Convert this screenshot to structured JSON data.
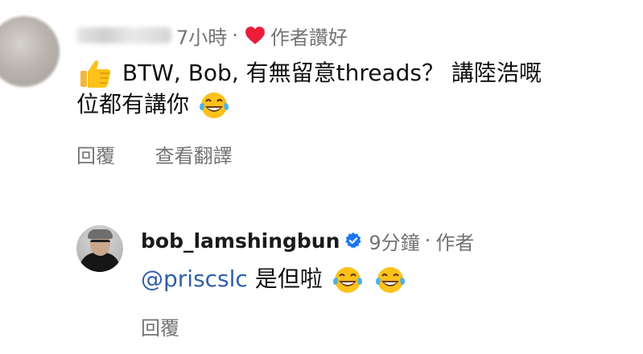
{
  "comments": [
    {
      "author_name_blurred": true,
      "time": "7小時",
      "separator": "·",
      "liked_by_author_label": "作者讚好",
      "text_line1": "BTW, Bob, 有無留意threads？ 講陸浩嘅",
      "text_line2": "位都有講你",
      "leading_emoji": "thumbs-up",
      "trailing_emoji": "face-with-tears-of-joy",
      "actions": [
        "回覆",
        "查看翻譯"
      ]
    },
    {
      "username": "bob_lamshingbun",
      "verified": true,
      "time": "9分鐘",
      "separator": "·",
      "author_label": "作者",
      "mention": "@priscslc",
      "text": "是但啦",
      "trailing_emojis": [
        "face-with-tears-of-joy",
        "face-with-tears-of-joy"
      ],
      "actions": [
        "回覆"
      ]
    }
  ],
  "colors": {
    "meta_text": "#737373",
    "mention": "#2f5fa8",
    "heart": "#ed1c3a",
    "verified": "#1877f2"
  }
}
